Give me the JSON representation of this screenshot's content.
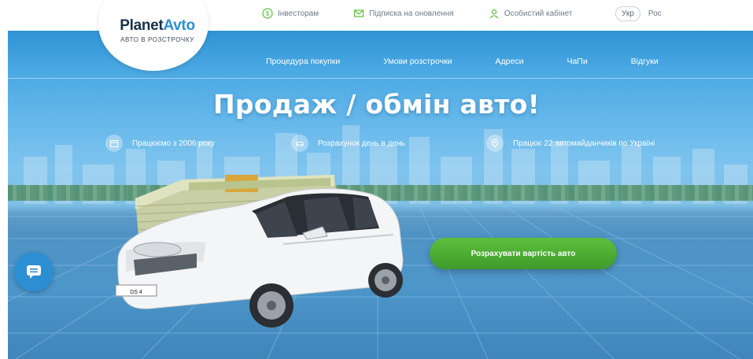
{
  "brand": {
    "name_dark": "Planet",
    "name_accent": "Avto",
    "tagline": "АВТО В РОЗСТРОЧКУ"
  },
  "top_links": [
    {
      "label": "Інвесторам",
      "icon": "dollar-circle-icon"
    },
    {
      "label": "Підписка на оновлення",
      "icon": "mail-icon"
    },
    {
      "label": "Особистий кабінет",
      "icon": "user-icon"
    }
  ],
  "languages": {
    "active": "Укр",
    "other": "Рос"
  },
  "nav": [
    {
      "label": "Процедура покупки"
    },
    {
      "label": "Умови розстрочки"
    },
    {
      "label": "Адреси"
    },
    {
      "label": "ЧаПи"
    },
    {
      "label": "Відгуки"
    }
  ],
  "hero": {
    "title": "Продаж / обмін авто!",
    "features": [
      {
        "text": "Працюємо з 2006 року",
        "icon": "calendar-icon"
      },
      {
        "text": "Розрахунок день в день",
        "icon": "car-icon"
      },
      {
        "text": "Працює 22 автомайданчиків по Україні",
        "icon": "location-pin-icon"
      }
    ],
    "cta_label": "Розрахувати вартість авто",
    "plate_text": "DS 4"
  },
  "colors": {
    "brand_blue": "#2a8fd6",
    "brand_dark": "#17324b",
    "cta_green": "#4aad33",
    "chat_blue": "#2d8fd3"
  }
}
